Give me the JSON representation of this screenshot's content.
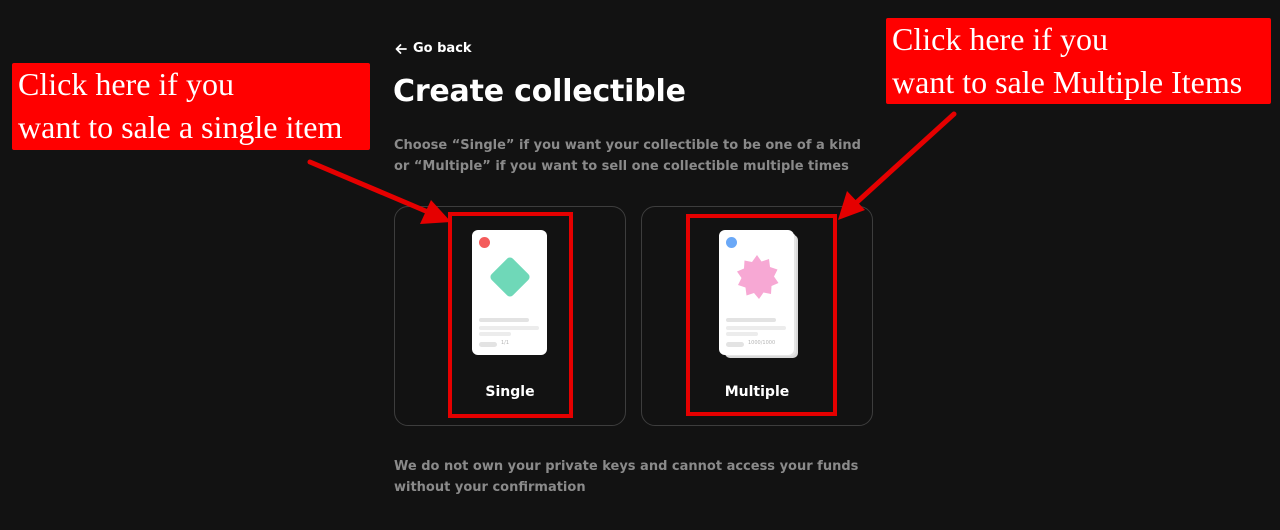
{
  "nav": {
    "back_label": "Go back"
  },
  "header": {
    "title": "Create collectible",
    "description": "Choose “Single” if you want your collectible to be one of a kind or “Multiple” if you want to sell one collectible multiple times"
  },
  "options": [
    {
      "label": "Single",
      "edition": "1/1",
      "dot_color": "#f45b5b",
      "art_color": "#6fd8b8"
    },
    {
      "label": "Multiple",
      "edition": "1000/1000",
      "dot_color": "#6aa8f7",
      "art_color": "#f7a8d4"
    }
  ],
  "footer": {
    "note": "We do not own your private keys and cannot access your funds without your confirmation"
  },
  "annotations": {
    "left_line1": "Click here if you",
    "left_line2": "want to sale a single item",
    "right_line1": "Click here if you",
    "right_line2": "want to sale Multiple Items",
    "color": "#ff0000"
  }
}
